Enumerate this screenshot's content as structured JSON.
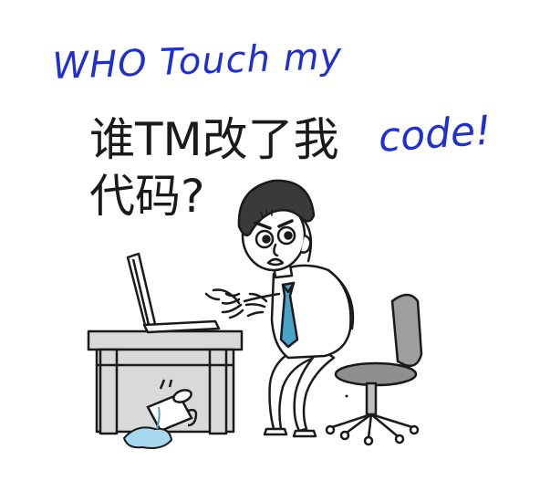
{
  "caption": {
    "english_line1": "WHO Touch my",
    "chinese_line1": "谁TM改了我",
    "english_code": "code!",
    "chinese_line2": "代码?"
  },
  "colors": {
    "handwriting_blue": "#1f2fd0",
    "tie_blue": "#4aa3c8",
    "desk_gray": "#d9d9d9",
    "ink": "#1a1a1a",
    "spill_blue": "#a8d8f0"
  },
  "scene": {
    "icons": [
      "laptop-icon",
      "desk",
      "office-chair",
      "coffee-mug",
      "spill",
      "angry-programmer"
    ]
  }
}
